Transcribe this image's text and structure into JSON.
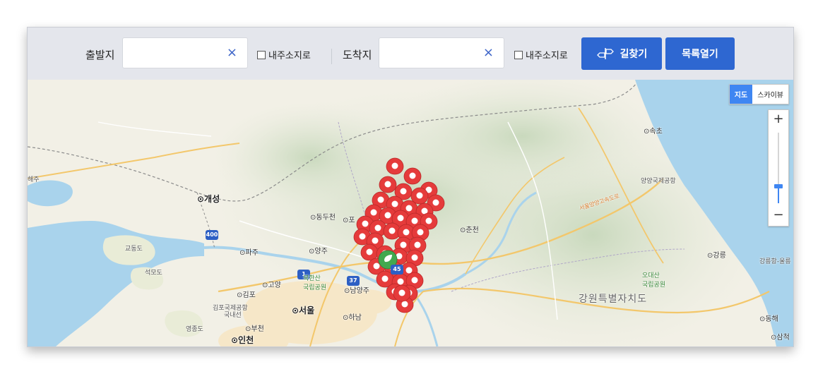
{
  "search": {
    "origin_label": "출발지",
    "origin_value": "",
    "origin_clear": "×",
    "origin_my_location": "내주소지로",
    "dest_label": "도착지",
    "dest_value": "",
    "dest_clear": "×",
    "dest_my_location": "내주소지로",
    "route_button": "길찾기",
    "list_button": "목록열기"
  },
  "map": {
    "type_map": "지도",
    "type_sky": "스카이뷰",
    "zoom_in": "+",
    "zoom_out": "−",
    "places": {
      "sokcho": "⊙속초",
      "yangyang_airport": "양양국제공항",
      "kaesong": "⊙개성",
      "dongducheon": "⊙동두천",
      "pocheon": "⊙포",
      "chuncheon": "⊙춘천",
      "paju": "⊙파주",
      "yangju": "⊙양주",
      "gangneung": "⊙강릉",
      "gyodongdo": "교동도",
      "seongmodo": "석모도",
      "goyang": "⊙고양",
      "bukhansan": "북한산\n국립공원",
      "gimpo": "⊙김포",
      "namyangju": "⊙남양주",
      "odaesan": "오대산\n국립공원",
      "gimpo_airport": "김포국제공항",
      "domestic": "국내선",
      "seoul": "⊙서울",
      "hanam": "⊙하남",
      "gangwon": "강원특별자치도",
      "yeongjongdo": "영종도",
      "bucheon": "⊙부천",
      "incheon": "⊙인천",
      "donghae": "⊙동해",
      "samcheok": "⊙삼척",
      "left_edge": "해주",
      "right_edge": "강릉항-울릉",
      "expressway": "서울양양고속도로"
    },
    "route_shields": [
      "400",
      "1",
      "37",
      "45"
    ]
  }
}
